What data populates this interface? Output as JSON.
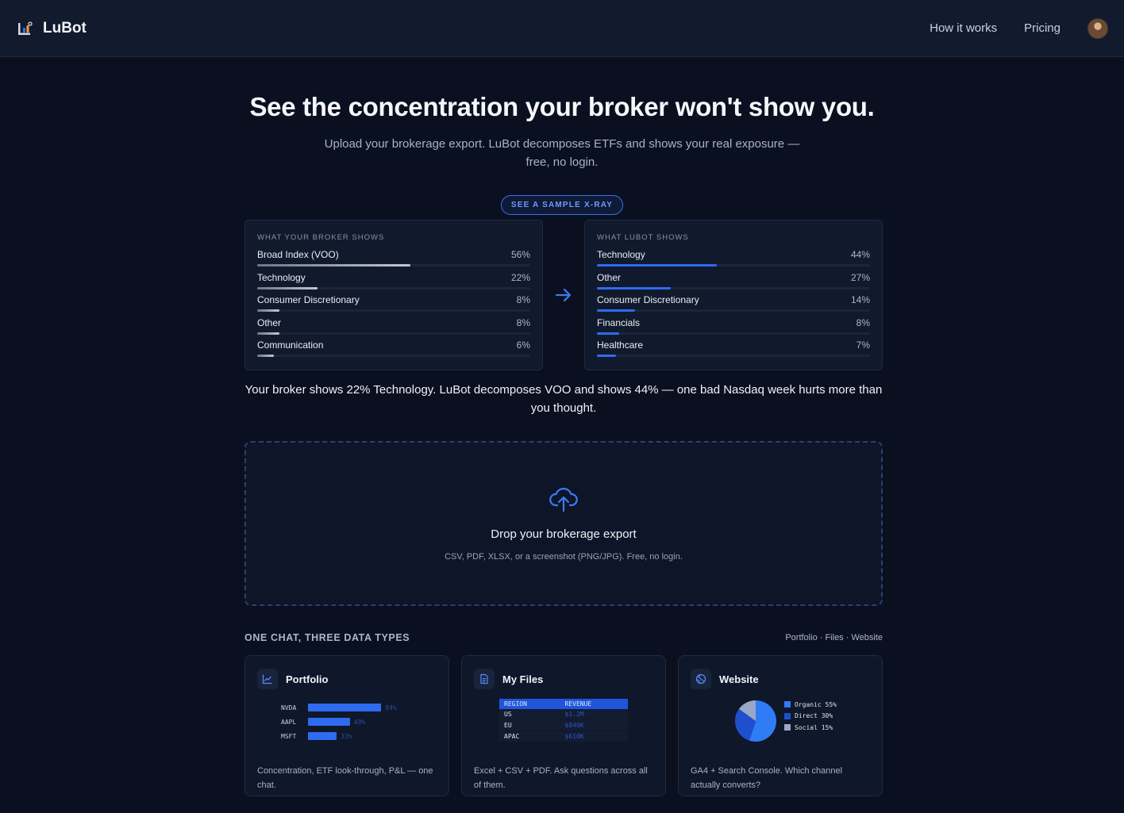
{
  "header": {
    "brand": "LuBot",
    "nav": [
      "How it works",
      "Pricing"
    ]
  },
  "hero": {
    "title": "See the concentration your broker won't show you.",
    "subtitle": "Upload your brokerage export. LuBot decomposes ETFs and shows your real exposure — free, no login.",
    "sample_button": "SEE A SAMPLE X-RAY"
  },
  "broker_panel": {
    "title": "WHAT YOUR BROKER SHOWS",
    "rows": [
      {
        "label": "Broad Index (VOO)",
        "pct": "56%",
        "value": 56
      },
      {
        "label": "Technology",
        "pct": "22%",
        "value": 22
      },
      {
        "label": "Consumer Discretionary",
        "pct": "8%",
        "value": 8
      },
      {
        "label": "Other",
        "pct": "8%",
        "value": 8
      },
      {
        "label": "Communication",
        "pct": "6%",
        "value": 6
      }
    ]
  },
  "lubot_panel": {
    "title": "WHAT LUBOT SHOWS",
    "rows": [
      {
        "label": "Technology",
        "pct": "44%",
        "value": 44
      },
      {
        "label": "Other",
        "pct": "27%",
        "value": 27
      },
      {
        "label": "Consumer Discretionary",
        "pct": "14%",
        "value": 14
      },
      {
        "label": "Financials",
        "pct": "8%",
        "value": 8
      },
      {
        "label": "Healthcare",
        "pct": "7%",
        "value": 7
      }
    ]
  },
  "verdict": "Your broker shows 22% Technology. LuBot decomposes VOO and shows 44% — one bad Nasdaq week hurts more than you thought.",
  "dropzone": {
    "title": "Drop your brokerage export",
    "subtitle": "CSV, PDF, XLSX, or a screenshot (PNG/JPG). Free, no login."
  },
  "features": {
    "title": "ONE CHAT, THREE DATA TYPES",
    "links": "Portfolio · Files · Website",
    "cards": [
      {
        "title": "Portfolio",
        "icon": "line-chart-icon",
        "desc": "Concentration, ETF look-through, P&L — one chat.",
        "bars": [
          {
            "ticker": "NVDA",
            "label": "84%",
            "value": 84
          },
          {
            "ticker": "AAPL",
            "label": "48%",
            "value": 48
          },
          {
            "ticker": "MSFT",
            "label": "33%",
            "value": 33
          }
        ]
      },
      {
        "title": "My Files",
        "icon": "document-icon",
        "desc": "Excel + CSV + PDF. Ask questions across all of them.",
        "table": {
          "headers": [
            "REGION",
            "REVENUE"
          ],
          "rows": [
            [
              "US",
              "$1.2M"
            ],
            [
              "EU",
              "$840K"
            ],
            [
              "APAC",
              "$610K"
            ]
          ]
        }
      },
      {
        "title": "Website",
        "icon": "globe-icon",
        "desc": "GA4 + Search Console. Which channel actually converts?",
        "legend": [
          {
            "label": "Organic 55%",
            "value": 55,
            "color": "#2f7cf6"
          },
          {
            "label": "Direct 30%",
            "value": 30,
            "color": "#1f4fcf"
          },
          {
            "label": "Social 15%",
            "value": 15,
            "color": "#9aa8c7"
          }
        ]
      }
    ]
  }
}
